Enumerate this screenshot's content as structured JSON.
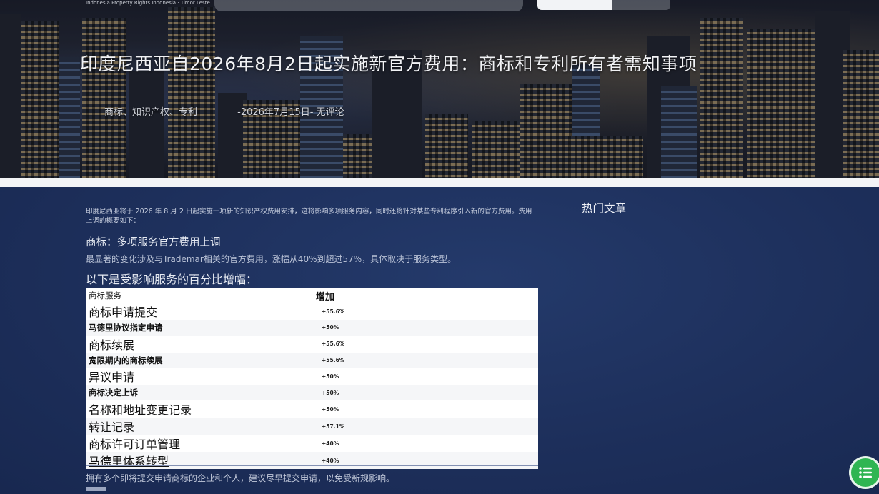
{
  "header": {
    "logo_text": "Indonesia Property Rights\nIndonesia · Timor Leste"
  },
  "article": {
    "title": "印度尼西亚自2026年8月2日起实施新官方费用：商标和专利所有者需知事项",
    "categories": "商标、知识产权、专利",
    "date_comments": "-2026年7月15日- 无评论",
    "intro": "印度尼西亚将于 2026 年 8 月 2 日起实施一项新的知识产权费用安排，这将影响多项服务内容，同时还将针对某些专利程序引入新的官方费用。费用上调的概要如下：",
    "trademark_heading": "商标：多项服务官方费用上调",
    "trademark_para": "最显著的变化涉及与Trademar相关的官方费用，涨幅从40%到超过57%，具体取决于服务类型。",
    "percent_heading": "以下是受影响服务的百分比增幅：",
    "table": {
      "headers": [
        "商标服务",
        "增加"
      ],
      "rows": [
        {
          "service": "商标申请提交",
          "increase": "+55.6%"
        },
        {
          "service": "马德里协议指定申请",
          "increase": "+50%"
        },
        {
          "service": "商标续展",
          "increase": "+55.6%"
        },
        {
          "service": "宽限期内的商标续展",
          "increase": "+55.6%"
        },
        {
          "service": "异议申请",
          "increase": "+50%"
        },
        {
          "service": "商标决定上诉",
          "increase": "+50%"
        },
        {
          "service": "名称和地址变更记录",
          "increase": "+50%"
        },
        {
          "service": "转让记录",
          "increase": "+57.1%"
        },
        {
          "service": "商标许可订单管理",
          "increase": "+40%"
        },
        {
          "service": "马德里体系转型",
          "increase": "+40%"
        }
      ]
    },
    "outro": "拥有多个即将提交申请商标的企业和个人，建议尽早提交申请，以免受新规影响。"
  },
  "sidebar": {
    "popular_title": "热门文章"
  },
  "icons": {
    "toc": "list-icon"
  },
  "colors": {
    "main_bg": "#1d2f5b",
    "toc_button": "#2fb552"
  }
}
